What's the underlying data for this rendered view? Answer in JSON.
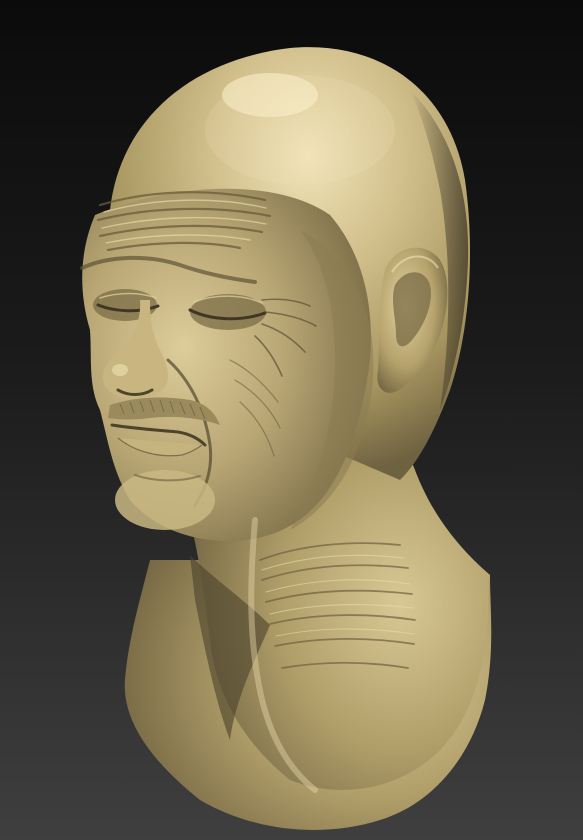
{
  "scene": {
    "subject": "sculpted-head-bust",
    "colors": {
      "background_top": "#0b0b0b",
      "background_bottom": "#3f3f3f",
      "clay_light": "#e6d7a6",
      "clay_mid": "#b9a774",
      "clay_dark": "#6f6241",
      "clay_shadow": "#3b3424"
    }
  }
}
